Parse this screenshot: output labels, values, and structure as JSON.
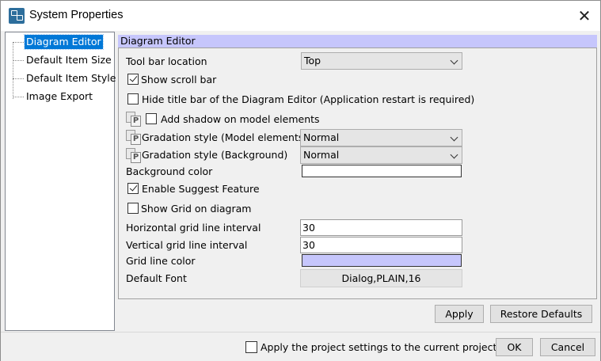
{
  "window": {
    "title": "System Properties",
    "close_glyph": "✕"
  },
  "tree": {
    "items": [
      {
        "label": "Diagram Editor",
        "selected": true
      },
      {
        "label": "Default Item Size",
        "selected": false
      },
      {
        "label": "Default Item Style",
        "selected": false
      },
      {
        "label": "Image Export",
        "selected": false
      }
    ]
  },
  "section": {
    "title": "Diagram Editor"
  },
  "settings": {
    "toolbar_location_label": "Tool bar location",
    "toolbar_location_value": "Top",
    "show_scroll_bar_label": "Show scroll bar",
    "show_scroll_bar_checked": true,
    "hide_title_bar_label": "Hide title bar of the Diagram Editor (Application restart is required)",
    "hide_title_bar_checked": false,
    "add_shadow_label": "Add shadow on model elements",
    "add_shadow_checked": false,
    "project_icon_letter": "P",
    "gradation_model_label": "Gradation style (Model elements)",
    "gradation_model_value": "Normal",
    "gradation_bg_label": "Gradation style (Background)",
    "gradation_bg_value": "Normal",
    "background_color_label": "Background color",
    "background_color_value": "#ffffff",
    "enable_suggest_label": "Enable Suggest Feature",
    "enable_suggest_checked": true,
    "show_grid_label": "Show Grid on diagram",
    "show_grid_checked": false,
    "h_grid_label": "Horizontal grid line interval",
    "h_grid_value": "30",
    "v_grid_label": "Vertical grid line interval",
    "v_grid_value": "30",
    "grid_color_label": "Grid line color",
    "grid_color_value": "#c6c6fc",
    "default_font_label": "Default Font",
    "default_font_value": "Dialog,PLAIN,16"
  },
  "buttons": {
    "apply": "Apply",
    "restore_defaults": "Restore Defaults",
    "ok": "OK",
    "cancel": "Cancel"
  },
  "footer": {
    "apply_project_label": "Apply the project settings to the current project",
    "apply_project_checked": false
  }
}
